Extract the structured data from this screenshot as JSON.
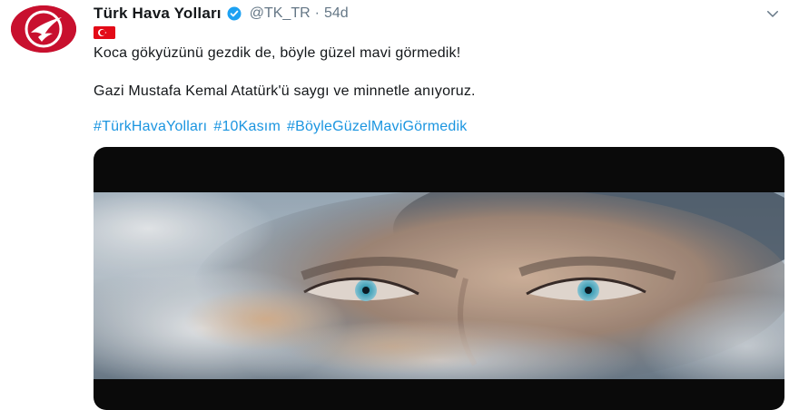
{
  "tweet": {
    "display_name": "Türk Hava Yolları",
    "handle": "@TK_TR",
    "separator": "·",
    "timestamp": "54d",
    "line1": "Koca gökyüzünü gezdik de, böyle güzel mavi görmedik!",
    "line2": "Gazi Mustafa Kemal Atatürk'ü saygı ve minnetle anıyoruz.",
    "hashtags": [
      "#TürkHavaYolları",
      "#10Kasım",
      "#BöyleGüzelMaviGörmedik"
    ]
  },
  "icons": {
    "avatar": "turkish-airlines-logo",
    "verified": "verified-badge-icon",
    "flag": "turkey-flag-emoji",
    "menu": "chevron-down-icon"
  },
  "colors": {
    "brand_red": "#c8102e",
    "link_blue": "#1b95e0",
    "secondary_text": "#657786",
    "verified_blue": "#1da1f2"
  }
}
